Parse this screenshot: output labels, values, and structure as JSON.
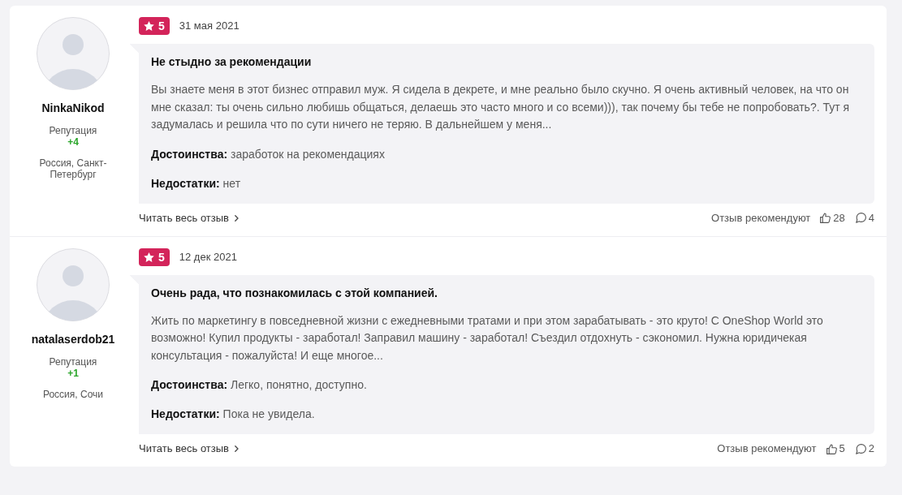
{
  "reviews": [
    {
      "author": {
        "name": "NinkaNikod",
        "reputation_label": "Репутация",
        "reputation": "+4",
        "location": "Россия, Санкт-Петербург"
      },
      "rating": "5",
      "date": "31 мая 2021",
      "title": "Не стыдно за рекомендации",
      "body": "Вы знаете меня в этот бизнес отправил муж. Я сидела в декрете, и мне реально было скучно. Я очень активный человек, на что он мне сказал: ты очень сильно любишь общаться, делаешь это часто много и со всеми))), так почему бы тебе не попробовать?. Тут я задумалась и решила что по сути ничего не теряю. В дальнейшем у меня...",
      "pros": {
        "label": "Достоинства:",
        "text": "заработок на рекомендациях"
      },
      "cons": {
        "label": "Недостатки:",
        "text": "нет"
      },
      "read_more": "Читать весь отзыв",
      "recommend_label": "Отзыв рекомендуют",
      "likes": "28",
      "comments": "4"
    },
    {
      "author": {
        "name": "natalaserdob21",
        "reputation_label": "Репутация",
        "reputation": "+1",
        "location": "Россия, Сочи"
      },
      "rating": "5",
      "date": "12 дек 2021",
      "title": "Очень рада, что познакомилась с этой компанией.",
      "body": "Жить по маркетингу в повседневной жизни с ежедневными тратами и при этом зарабатывать - это круто! С OneShop World это возможно! Купил продукты - заработал! Заправил машину - заработал! Съездил отдохнуть - сэкономил. Нужна юридичекая консультация - пожалуйста! И еще многое...",
      "pros": {
        "label": "Достоинства:",
        "text": "Легко, понятно, доступно."
      },
      "cons": {
        "label": "Недостатки:",
        "text": "Пока не увидела."
      },
      "read_more": "Читать весь отзыв",
      "recommend_label": "Отзыв рекомендуют",
      "likes": "5",
      "comments": "2"
    }
  ]
}
